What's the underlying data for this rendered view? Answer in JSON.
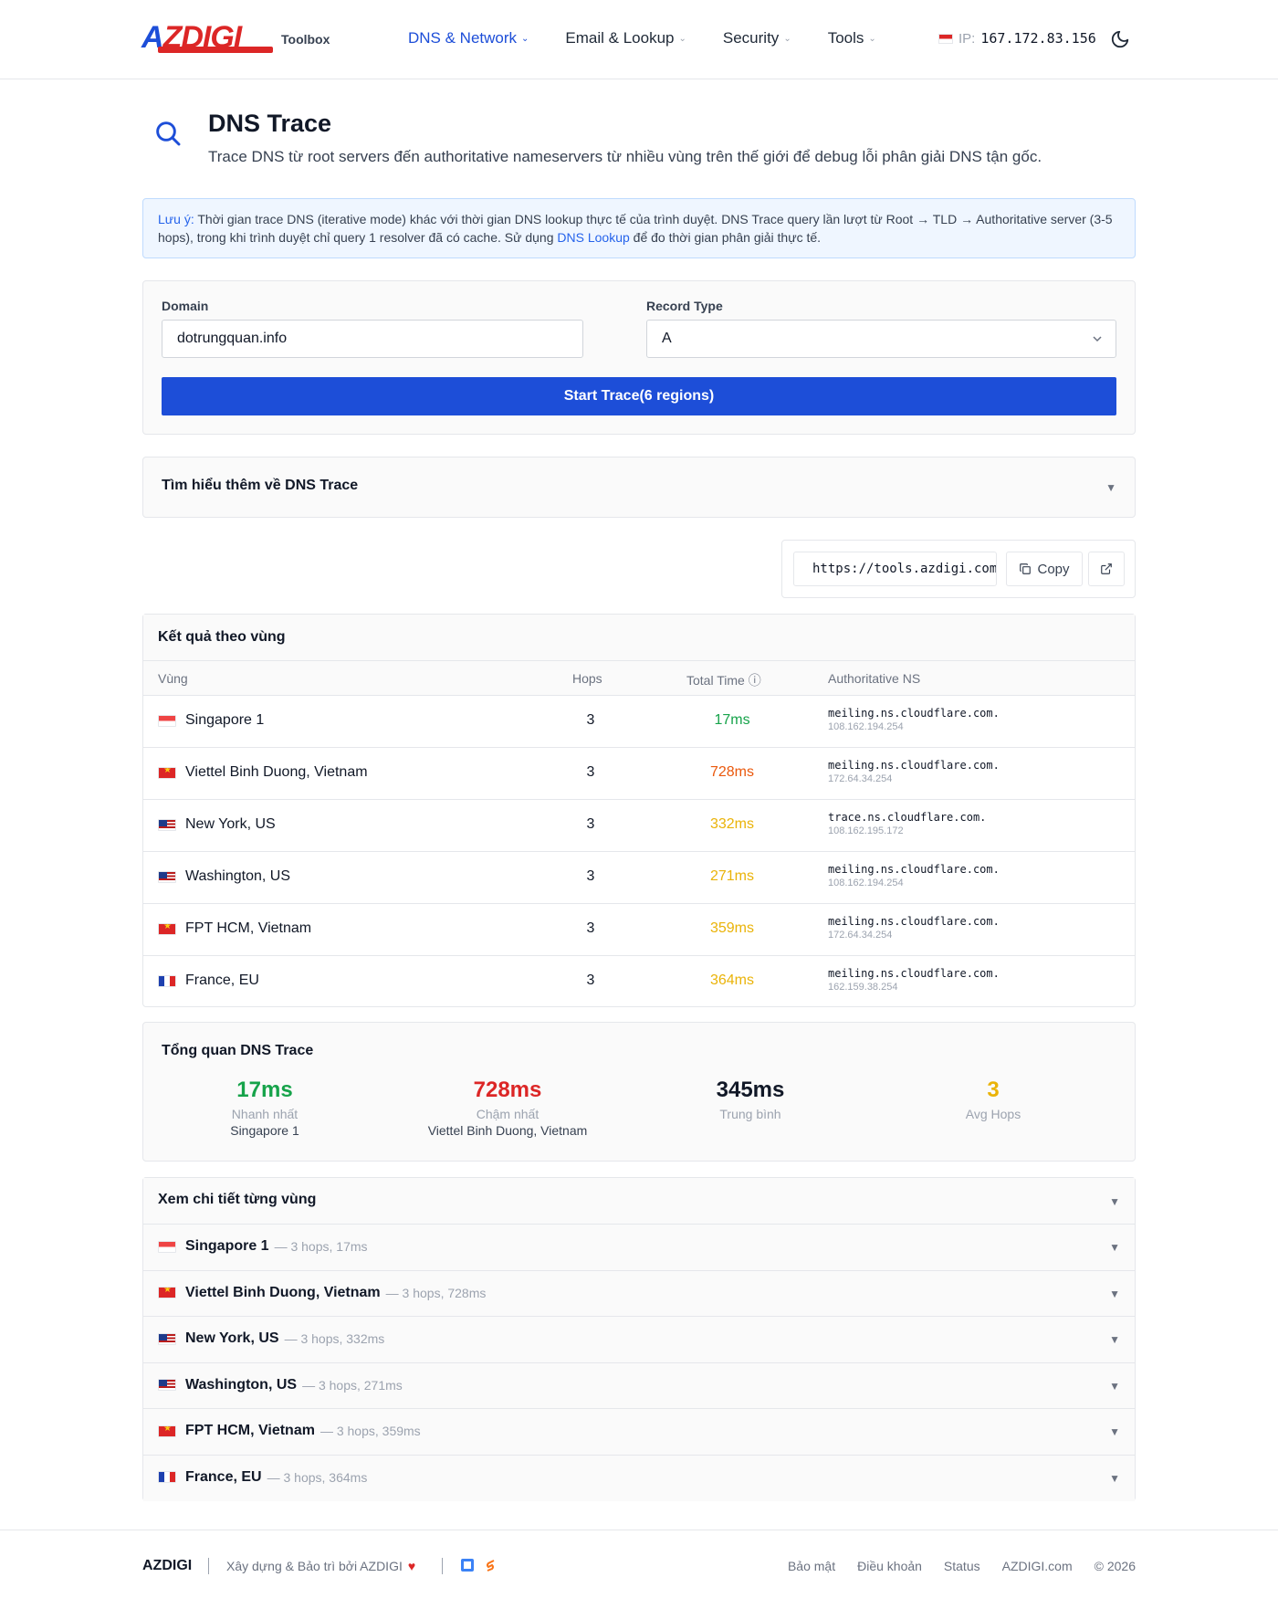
{
  "header": {
    "logo_text_a": "A",
    "logo_text_rest": "ZDIGI",
    "toolbox_label": "Toolbox",
    "nav": [
      {
        "label": "DNS & Network"
      },
      {
        "label": "Email & Lookup"
      },
      {
        "label": "Security"
      },
      {
        "label": "Tools"
      }
    ],
    "ip_label": "IP:",
    "ip_value": "167.172.83.156"
  },
  "page": {
    "title": "DNS Trace",
    "subtitle": "Trace DNS từ root servers đến authoritative nameservers từ nhiều vùng trên thế giới để debug lỗi phân giải DNS tận gốc."
  },
  "notice": {
    "emphasis": "Lưu ý:",
    "text_1": " Thời gian trace DNS (iterative mode) khác với thời gian DNS lookup thực tế của trình duyệt. DNS Trace query lần lượt từ Root → TLD → Authoritative server (3-5 hops), trong khi trình duyệt chỉ query 1 resolver đã có cache. Sử dụng ",
    "link": "DNS Lookup",
    "text_2": " để đo thời gian phân giải thực tế."
  },
  "form": {
    "domain_label": "Domain",
    "domain_value": "dotrungquan.info",
    "record_label": "Record Type",
    "record_value": "A",
    "start_button": "Start Trace(6 regions)"
  },
  "learn_more": {
    "label": "Tìm hiểu thêm về DNS Trace"
  },
  "share": {
    "url": "https://tools.azdigi.com/dns-trace",
    "copy_label": "Copy"
  },
  "results": {
    "title": "Kết quả theo vùng",
    "columns": {
      "region": "Vùng",
      "hops": "Hops",
      "time": "Total Time ⓘ",
      "ns": "Authoritative NS"
    },
    "rows": [
      {
        "flag": "sg",
        "region": "Singapore 1",
        "hops": "3",
        "time": "17ms",
        "time_color": "#16a34a",
        "ns": "meiling.ns.cloudflare.com.",
        "ns_ip": "108.162.194.254"
      },
      {
        "flag": "vn",
        "region": "Viettel Binh Duong, Vietnam",
        "hops": "3",
        "time": "728ms",
        "time_color": "#ea580c",
        "ns": "meiling.ns.cloudflare.com.",
        "ns_ip": "172.64.34.254"
      },
      {
        "flag": "us",
        "region": "New York, US",
        "hops": "3",
        "time": "332ms",
        "time_color": "#eab308",
        "ns": "trace.ns.cloudflare.com.",
        "ns_ip": "108.162.195.172"
      },
      {
        "flag": "us",
        "region": "Washington, US",
        "hops": "3",
        "time": "271ms",
        "time_color": "#eab308",
        "ns": "meiling.ns.cloudflare.com.",
        "ns_ip": "108.162.194.254"
      },
      {
        "flag": "vn",
        "region": "FPT HCM, Vietnam",
        "hops": "3",
        "time": "359ms",
        "time_color": "#eab308",
        "ns": "meiling.ns.cloudflare.com.",
        "ns_ip": "172.64.34.254"
      },
      {
        "flag": "fr",
        "region": "France, EU",
        "hops": "3",
        "time": "364ms",
        "time_color": "#eab308",
        "ns": "meiling.ns.cloudflare.com.",
        "ns_ip": "162.159.38.254"
      }
    ]
  },
  "summary": {
    "title": "Tổng quan DNS Trace",
    "fastest": {
      "value": "17ms",
      "label": "Nhanh nhất",
      "region": "Singapore 1",
      "color": "#16a34a"
    },
    "slowest": {
      "value": "728ms",
      "label": "Chậm nhất",
      "region": "Viettel Binh Duong, Vietnam",
      "color": "#dc2626"
    },
    "average": {
      "value": "345ms",
      "label": "Trung bình",
      "color": "#111827"
    },
    "avg_hops": {
      "value": "3",
      "label": "Avg Hops",
      "color": "#eab308"
    }
  },
  "details": {
    "title": "Xem chi tiết từng vùng",
    "rows": [
      {
        "flag": "sg",
        "region": "Singapore 1",
        "meta": "— 3 hops, 17ms"
      },
      {
        "flag": "vn",
        "region": "Viettel Binh Duong, Vietnam",
        "meta": "— 3 hops, 728ms"
      },
      {
        "flag": "us",
        "region": "New York, US",
        "meta": "— 3 hops, 332ms"
      },
      {
        "flag": "us",
        "region": "Washington, US",
        "meta": "— 3 hops, 271ms"
      },
      {
        "flag": "vn",
        "region": "FPT HCM, Vietnam",
        "meta": "— 3 hops, 359ms"
      },
      {
        "flag": "fr",
        "region": "France, EU",
        "meta": "— 3 hops, 364ms"
      }
    ]
  },
  "footer": {
    "brand": "AZDIGI",
    "built_by": "Xây dựng & Bảo trì bởi AZDIGI",
    "links": [
      "Bảo mật",
      "Điều khoản",
      "Status",
      "AZDIGI.com",
      "© 2026"
    ]
  }
}
